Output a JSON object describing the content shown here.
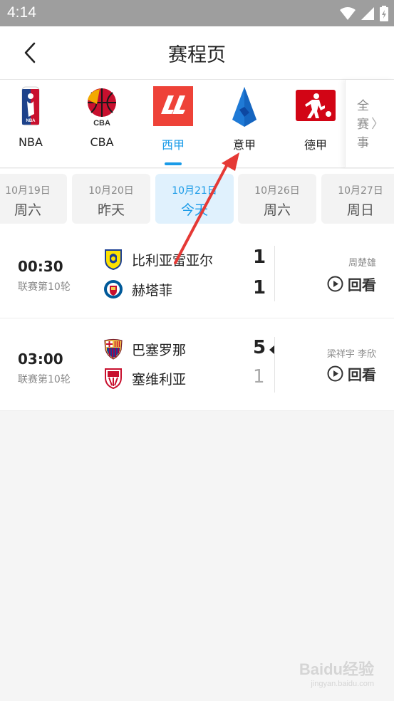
{
  "status_bar": {
    "time": "4:14"
  },
  "header": {
    "title": "赛程页"
  },
  "leagues": [
    {
      "label": "NBA",
      "icon": "nba-logo-icon"
    },
    {
      "label": "CBA",
      "icon": "cba-logo-icon"
    },
    {
      "label": "西甲",
      "icon": "laliga-logo-icon",
      "active": true
    },
    {
      "label": "意甲",
      "icon": "serie-a-logo-icon"
    },
    {
      "label": "德甲",
      "icon": "bundesliga-logo-icon"
    }
  ],
  "all_events": {
    "label": "全赛事",
    "arrow": "〉"
  },
  "dates": [
    {
      "date": "10月19日",
      "weekday": "周六"
    },
    {
      "date": "10月20日",
      "weekday": "昨天"
    },
    {
      "date": "10月21日",
      "weekday": "今天",
      "active": true
    },
    {
      "date": "10月26日",
      "weekday": "周六"
    },
    {
      "date": "10月27日",
      "weekday": "周日"
    }
  ],
  "matches": [
    {
      "time": "00:30",
      "round": "联赛第10轮",
      "home": {
        "name": "比利亚雷亚尔",
        "score": "1",
        "badge": "villarreal-badge-icon"
      },
      "away": {
        "name": "赫塔菲",
        "score": "1",
        "badge": "getafe-badge-icon"
      },
      "commentator": "周楚雄",
      "replay_label": "回看"
    },
    {
      "time": "03:00",
      "round": "联赛第10轮",
      "home": {
        "name": "巴塞罗那",
        "score": "5",
        "badge": "barcelona-badge-icon"
      },
      "away": {
        "name": "塞维利亚",
        "score": "1",
        "badge": "sevilla-badge-icon"
      },
      "commentator": "梁祥宇 李欣",
      "replay_label": "回看"
    }
  ],
  "watermark": {
    "brand": "Baidu经验",
    "url": "jingyan.baidu.com"
  },
  "colors": {
    "accent": "#1a9be8",
    "annotation": "#e53935",
    "status_bar": "#9e9e9e"
  }
}
